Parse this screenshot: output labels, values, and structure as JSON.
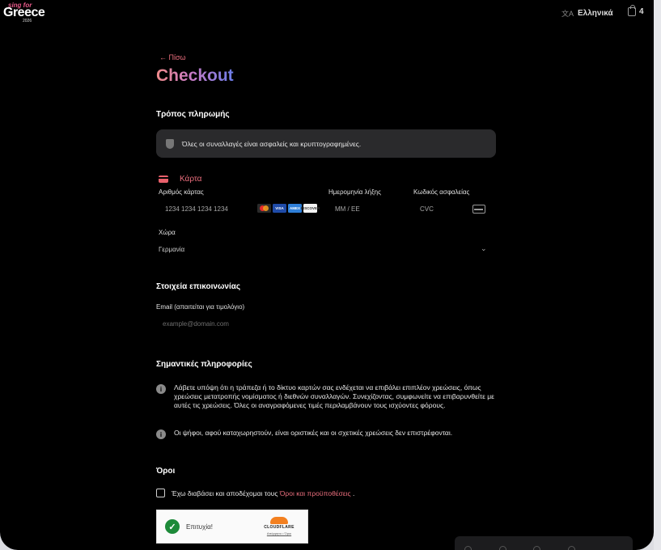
{
  "header": {
    "logo": {
      "line1": "sing for",
      "line2": "Greece",
      "line3": "2026"
    },
    "language": "Ελληνικά",
    "cart_count": "4"
  },
  "page": {
    "back_label": "← Πίσω",
    "title": "Checkout"
  },
  "payment": {
    "heading": "Τρόπος πληρωμής",
    "secure_notice": "Όλες οι συναλλαγές είναι ασφαλείς και κρυπτογραφημένες.",
    "method_label": "Κάρτα",
    "card_number_label": "Αριθμός κάρτας",
    "card_number_placeholder": "1234 1234 1234 1234",
    "expiry_label": "Ημερομηνία λήξης",
    "expiry_placeholder": "ΜΜ / ΕΕ",
    "cvc_label": "Κωδικός ασφαλείας",
    "cvc_placeholder": "CVC",
    "brands": [
      "VISA",
      "AMEX",
      "DISCOVER"
    ],
    "country_label": "Χώρα",
    "country_value": "Γερμανία"
  },
  "contact": {
    "heading": "Στοιχεία επικοινωνίας",
    "email_label": "Email (απαιτείται για τιμολόγιο)",
    "email_placeholder": "example@domain.com"
  },
  "info": {
    "heading": "Σημαντικές πληροφορίες",
    "line1": "Λάβετε υπόψη ότι η τράπεζα ή το δίκτυο καρτών σας ενδέχεται να επιβάλει επιπλέον χρεώσεις, όπως χρεώσεις μετατροπής νομίσματος ή διεθνών συναλλαγών. Συνεχίζοντας, συμφωνείτε να επιβαρυνθείτε με αυτές τις χρεώσεις. Όλες οι αναγραφόμενες τιμές περιλαμβάνουν τους ισχύοντες φόρους.",
    "line2": "Οι ψήφοι, αφού καταχωρηστούν, είναι οριστικές και οι σχετικές χρεώσεις δεν επιστρέφονται."
  },
  "terms": {
    "heading": "Όροι",
    "checkbox_text": "Έχω διαβάσει και αποδέχομαι τους ",
    "link_text": "Όροι και προϋποθέσεις",
    "suffix": " ."
  },
  "captcha": {
    "status": "Επιτυχία!",
    "brand": "CLOUDFLARE",
    "links": "Απόρρητο • Όροι"
  },
  "colors": {
    "accent": "#ec6f7e",
    "background": "#000000",
    "panel": "#2a2a2c"
  }
}
